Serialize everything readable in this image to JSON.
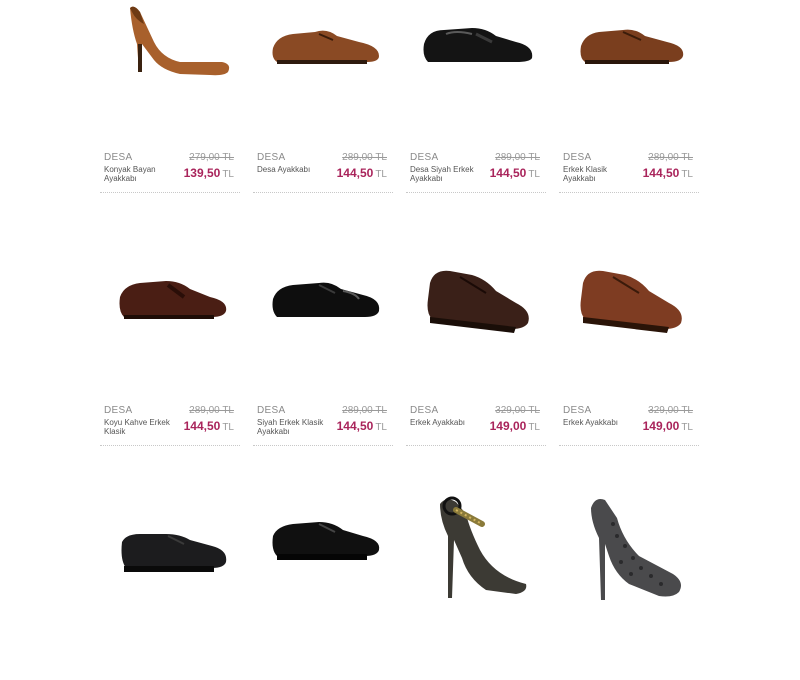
{
  "products": [
    {
      "brand": "DESA",
      "name": "Konyak Bayan Ayakkabı",
      "old_price": "279,00 TL",
      "new_price": "139,50",
      "currency": "TL",
      "image": "tan-pump-heel"
    },
    {
      "brand": "DESA",
      "name": "Desa Ayakkabı",
      "old_price": "289,00 TL",
      "new_price": "144,50",
      "currency": "TL",
      "image": "brown-cap-toe-shoe"
    },
    {
      "brand": "DESA",
      "name": "Desa Siyah Erkek Ayakkabı",
      "old_price": "289,00 TL",
      "new_price": "144,50",
      "currency": "TL",
      "image": "black-patent-loafer"
    },
    {
      "brand": "DESA",
      "name": "Erkek Klasik Ayakkabı",
      "old_price": "289,00 TL",
      "new_price": "144,50",
      "currency": "TL",
      "image": "brown-oxford-shoe"
    },
    {
      "brand": "DESA",
      "name": "Koyu Kahve Erkek Klasik",
      "old_price": "289,00 TL",
      "new_price": "144,50",
      "currency": "TL",
      "image": "dark-brown-loafer"
    },
    {
      "brand": "DESA",
      "name": "Siyah Erkek Klasik Ayakkabı",
      "old_price": "289,00 TL",
      "new_price": "144,50",
      "currency": "TL",
      "image": "black-cap-toe-shoe"
    },
    {
      "brand": "DESA",
      "name": "Erkek Ayakkabı",
      "old_price": "329,00 TL",
      "new_price": "149,00",
      "currency": "TL",
      "image": "dark-brogue-shoe"
    },
    {
      "brand": "DESA",
      "name": "Erkek Ayakkabı",
      "old_price": "329,00 TL",
      "new_price": "149,00",
      "currency": "TL",
      "image": "brown-brogue-shoe"
    },
    {
      "image": "black-matte-oxford"
    },
    {
      "image": "black-leather-oxford"
    },
    {
      "image": "ankle-strap-heel"
    },
    {
      "image": "studded-platform-heel"
    }
  ]
}
